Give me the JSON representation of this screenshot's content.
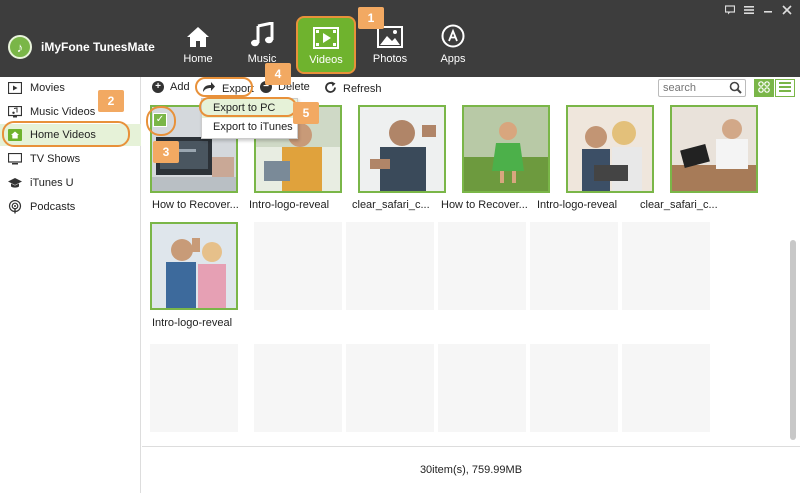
{
  "app": {
    "title": "iMyFone TunesMate"
  },
  "window_controls": [
    "feedback-icon",
    "menu-icon",
    "minimize-icon",
    "close-icon"
  ],
  "nav": {
    "tabs": [
      {
        "label": "Home",
        "icon": "home-icon"
      },
      {
        "label": "Music",
        "icon": "music-icon"
      },
      {
        "label": "Videos",
        "icon": "videos-icon",
        "active": true
      },
      {
        "label": "Photos",
        "icon": "photos-icon"
      },
      {
        "label": "Apps",
        "icon": "apps-icon"
      }
    ]
  },
  "toolbar": {
    "add_label": "Add",
    "export_label": "Export",
    "delete_label": "Delete",
    "refresh_label": "Refresh",
    "search_placeholder": "search"
  },
  "export_menu": {
    "items": [
      "Export to PC",
      "Export to iTunes"
    ]
  },
  "sidebar": {
    "items": [
      {
        "label": "Movies",
        "icon": "movie-icon"
      },
      {
        "label": "Music Videos",
        "icon": "music-video-icon"
      },
      {
        "label": "Home Videos",
        "icon": "home-video-icon",
        "active": true
      },
      {
        "label": "TV Shows",
        "icon": "tv-icon"
      },
      {
        "label": "iTunes U",
        "icon": "graduation-cap-icon"
      },
      {
        "label": "Podcasts",
        "icon": "podcast-icon"
      }
    ]
  },
  "videos": [
    {
      "caption": "How to Recover...",
      "selected": true
    },
    {
      "caption": "Intro-logo-reveal"
    },
    {
      "caption": "clear_safari_c..."
    },
    {
      "caption": "How to Recover..."
    },
    {
      "caption": "Intro-logo-reveal"
    },
    {
      "caption": "clear_safari_c..."
    },
    {
      "caption": "Intro-logo-reveal"
    }
  ],
  "status": {
    "summary": "30item(s), 759.99MB"
  },
  "callouts": [
    "1",
    "2",
    "3",
    "4",
    "5"
  ],
  "colors": {
    "accent_green": "#6fb32e",
    "highlight_orange": "#e8913a",
    "badge_orange": "#f2a962",
    "titlebar": "#3d3d3d"
  }
}
